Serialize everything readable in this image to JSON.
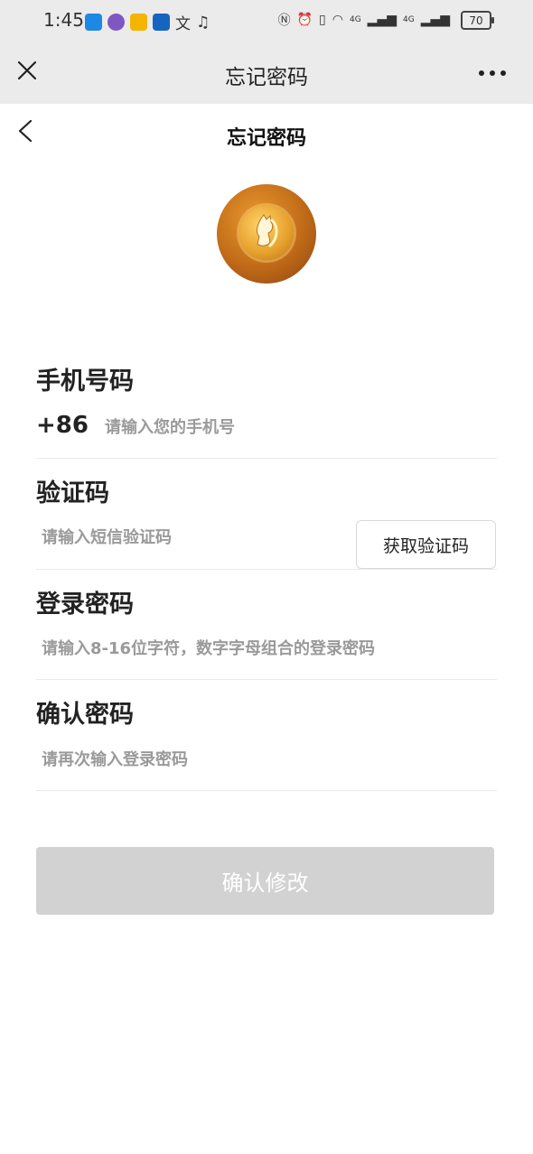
{
  "status_bar": {
    "time": "1:45",
    "network_labels": [
      "4G",
      "4G"
    ],
    "battery": "70"
  },
  "nav_bar": {
    "title": "忘记密码"
  },
  "page_header": {
    "title": "忘记密码"
  },
  "form": {
    "phone": {
      "label": "手机号码",
      "country_code": "+86",
      "placeholder": "请输入您的手机号",
      "value": ""
    },
    "code": {
      "label": "验证码",
      "placeholder": "请输入短信验证码",
      "value": "",
      "button_label": "获取验证码"
    },
    "password": {
      "label": "登录密码",
      "placeholder": "请输入8-16位字符，数字字母组合的登录密码",
      "value": ""
    },
    "confirm": {
      "label": "确认密码",
      "placeholder": "请再次输入登录密码",
      "value": ""
    }
  },
  "submit_button": {
    "label": "确认修改",
    "color": "#d2d2d2"
  },
  "colors": {
    "topbar_bg": "#ebebeb",
    "logo_primary": "#c06a18",
    "logo_accent": "#ffd36a"
  }
}
